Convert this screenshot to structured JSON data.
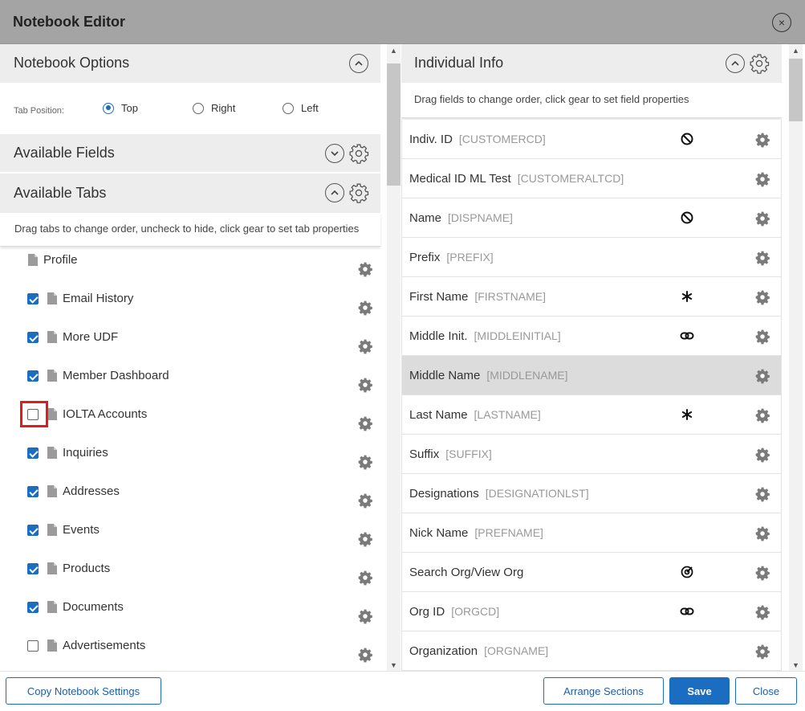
{
  "window": {
    "title": "Notebook Editor",
    "close_glyph": "×"
  },
  "notebook_options": {
    "title": "Notebook Options",
    "tab_position_label": "Tab Position:",
    "tab_positions": [
      {
        "label": "Top",
        "selected": true
      },
      {
        "label": "Right",
        "selected": false
      },
      {
        "label": "Left",
        "selected": false
      }
    ]
  },
  "available_fields": {
    "title": "Available Fields"
  },
  "available_tabs": {
    "title": "Available Tabs",
    "hint": "Drag tabs to change order, uncheck to hide, click gear to set tab properties",
    "tabs": [
      {
        "label": "Profile",
        "checkbox": false,
        "checked": false
      },
      {
        "label": "Email History",
        "checkbox": true,
        "checked": true
      },
      {
        "label": "More UDF",
        "checkbox": true,
        "checked": true
      },
      {
        "label": "Member Dashboard",
        "checkbox": true,
        "checked": true
      },
      {
        "label": "IOLTA Accounts",
        "checkbox": true,
        "checked": false,
        "highlighted": true
      },
      {
        "label": "Inquiries",
        "checkbox": true,
        "checked": true
      },
      {
        "label": "Addresses",
        "checkbox": true,
        "checked": true
      },
      {
        "label": "Events",
        "checkbox": true,
        "checked": true
      },
      {
        "label": "Products",
        "checkbox": true,
        "checked": true
      },
      {
        "label": "Documents",
        "checkbox": true,
        "checked": true
      },
      {
        "label": "Advertisements",
        "checkbox": true,
        "checked": false
      }
    ]
  },
  "individual_info": {
    "title": "Individual Info",
    "hint": "Drag fields to change order, click gear to set field properties",
    "fields": [
      {
        "label": "Indiv. ID",
        "code": "[CUSTOMERCD]",
        "icon": "ban-icon"
      },
      {
        "label": "Medical ID ML Test",
        "code": "[CUSTOMERALTCD]",
        "icon": ""
      },
      {
        "label": "Name",
        "code": "[DISPNAME]",
        "icon": "ban-icon"
      },
      {
        "label": "Prefix",
        "code": "[PREFIX]",
        "icon": ""
      },
      {
        "label": "First Name",
        "code": "[FIRSTNAME]",
        "icon": "asterisk-icon"
      },
      {
        "label": "Middle Init.",
        "code": "[MIDDLEINITIAL]",
        "icon": "link-icon"
      },
      {
        "label": "Middle Name",
        "code": "[MIDDLENAME]",
        "icon": "",
        "selected": true
      },
      {
        "label": "Last Name",
        "code": "[LASTNAME]",
        "icon": "asterisk-icon"
      },
      {
        "label": "Suffix",
        "code": "[SUFFIX]",
        "icon": ""
      },
      {
        "label": "Designations",
        "code": "[DESIGNATIONLST]",
        "icon": ""
      },
      {
        "label": "Nick Name",
        "code": "[PREFNAME]",
        "icon": ""
      },
      {
        "label": "Search Org/View Org",
        "code": "",
        "icon": "target-icon"
      },
      {
        "label": "Org ID",
        "code": "[ORGCD]",
        "icon": "link-icon"
      },
      {
        "label": "Organization",
        "code": "[ORGNAME]",
        "icon": ""
      }
    ]
  },
  "footer": {
    "copy_label": "Copy Notebook Settings",
    "arrange_label": "Arrange Sections",
    "save_label": "Save",
    "close_label": "Close"
  },
  "colors": {
    "accent": "#1b6dc1",
    "header_bg": "#a4a4a4",
    "section_bg": "#ededed",
    "highlight": "#e21b1b"
  }
}
